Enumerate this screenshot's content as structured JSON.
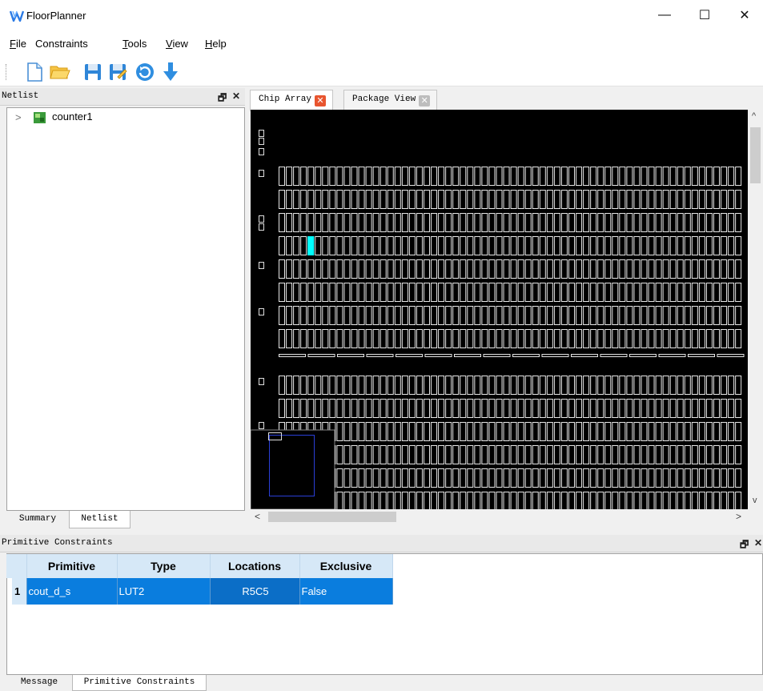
{
  "window": {
    "title": "FloorPlanner",
    "minimize": "—",
    "maximize": "☐",
    "close": "✕"
  },
  "menu": [
    {
      "label": "File",
      "mnemonic": "F",
      "rest": "ile"
    },
    {
      "label": "Constraints",
      "mnemonic": "",
      "rest": "Constraints"
    },
    {
      "label": "Tools",
      "mnemonic": "T",
      "rest": "ools"
    },
    {
      "label": "View",
      "mnemonic": "V",
      "rest": "iew"
    },
    {
      "label": "Help",
      "mnemonic": "H",
      "rest": "elp"
    }
  ],
  "toolbar": {
    "icons": [
      "new-file-icon",
      "open-folder-icon",
      "save-icon",
      "save-as-icon",
      "refresh-icon",
      "download-icon"
    ]
  },
  "netlist_pane": {
    "title": "Netlist",
    "float_glyph": "🗗",
    "close_glyph": "✕",
    "tree": [
      {
        "label": "counter1",
        "expander": ">"
      }
    ],
    "tabs": [
      {
        "label": "Summary",
        "active": false
      },
      {
        "label": "Netlist",
        "active": true
      }
    ]
  },
  "chip_view": {
    "tabs": [
      {
        "label": "Chip Array",
        "active": true,
        "close_color": "#e8552f"
      },
      {
        "label": "Package View",
        "active": false,
        "close_color": "#bdbdbd"
      }
    ],
    "highlight_color": "#00ffff",
    "scroll_left": "<",
    "scroll_right": ">",
    "scroll_up": "^",
    "scroll_down": "v"
  },
  "constraints_pane": {
    "title": "Primitive Constraints",
    "float_glyph": "🗗",
    "close_glyph": "✕",
    "columns": [
      "Primitive",
      "Type",
      "Locations",
      "Exclusive"
    ],
    "rows": [
      {
        "num": "1",
        "primitive": "cout_d_s",
        "type": "LUT2",
        "locations": "R5C5",
        "exclusive": "False"
      }
    ],
    "selection_color": "#0a7dde"
  },
  "bottom_tabs": [
    {
      "label": "Message",
      "active": false
    },
    {
      "label": "Primitive Constraints",
      "active": true
    }
  ]
}
